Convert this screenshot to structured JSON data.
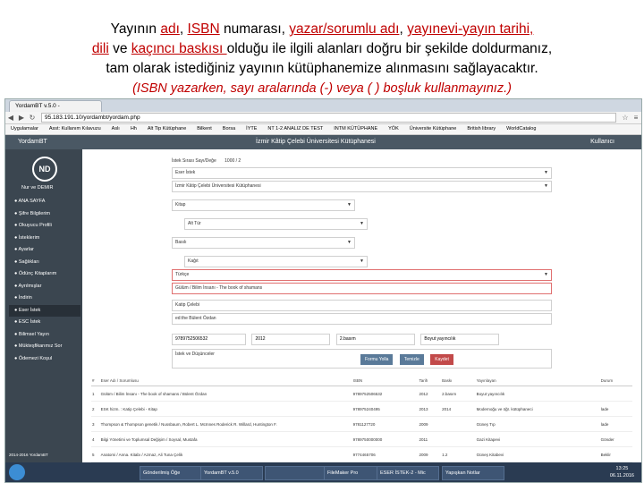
{
  "instructions": {
    "line1": [
      {
        "t": "Yayının ",
        "red": false
      },
      {
        "t": "adı",
        "red": true
      },
      {
        "t": ", ",
        "red": false
      },
      {
        "t": "ISBN",
        "red": true
      },
      {
        "t": " numarası, ",
        "red": false
      },
      {
        "t": "yazar/sorumlu adı",
        "red": true
      },
      {
        "t": ", ",
        "red": false
      },
      {
        "t": "yayınevi-yayın tarihi,",
        "red": true
      }
    ],
    "line2": [
      {
        "t": "dili",
        "red": true
      },
      {
        "t": " ve ",
        "red": false
      },
      {
        "t": "kaçıncı baskısı ",
        "red": true
      },
      {
        "t": "olduğu  ile ilgili alanları doğru bir şekilde doldurmanız,",
        "red": false
      }
    ],
    "line3": "tam olarak istediğiniz yayının kütüphanemize alınmasını sağlayacaktır.",
    "note": "(ISBN yazarken, sayı aralarında (-) veya (  ) boşluk kullanmayınız.)"
  },
  "browser": {
    "tab": "YordamBT v.5.0 -",
    "url": "95.183.191.10/yordambt/yordam.php",
    "bookmarks": [
      "Uygulamalar",
      "Asst: Kullanım Kılavuzu",
      "Aslı",
      "Hh",
      "Alt Tip Kütüphane",
      "Bilkent",
      "Borsa",
      "İYTE",
      "NT 1-2 ANALIZ DE TEST",
      "INTM KÜTÜPHANE",
      "YÖK",
      "Üniversite Kütüphane",
      "British library",
      "WorldCatalog"
    ]
  },
  "app": {
    "brand": "YordamBT",
    "title": "İzmir Kâtip Çelebi Üniversitesi Kütüphanesi",
    "user_button": "Kullanıcı",
    "avatar": "ND",
    "username": "Nur ve DEMIR",
    "menu": [
      "ANA SAYFA",
      "Şifre Bilgilerim",
      "Okuyucu Profili",
      "İsteklerim",
      "Ayarlar",
      "Sağlıkları",
      "Ödünç Kitaplarım",
      "Ayrılmışlar",
      "İndirin",
      "Eser İstek",
      "ESC İstek",
      "Bilimsel Yayın",
      "Mükteşfikarımız Sor",
      "Ödemezi Koşul"
    ],
    "active_menu": 9,
    "footer": "2014-2016 YordamBT"
  },
  "form": {
    "request_date_label": "İstek Sırası Sayı/Değe",
    "request_date": "1000 / 2",
    "request_type": "Eser İstek",
    "library": "İzmir Kâtip Çelebi Üniversitesi Kütüphanesi",
    "material_type": "Kitap",
    "item_type": "Alt Tür",
    "format": "Basılı",
    "format2": "Kağıt",
    "language": "Türkçe",
    "title_field": "Gülüm / Bilim İnsanı - The book of shamans",
    "author": "Katip Çelebi",
    "editor": "ed:the  Bülent Özdan",
    "isbn": "9789752506532",
    "year": "2012",
    "edition": "2.basım",
    "publisher": "Boyut yayıncılık",
    "notes_label": "İstek ve Düşünceler",
    "buttons": [
      "Formu Yolla",
      "Temizle",
      "Kaydet"
    ]
  },
  "table": {
    "headers": [
      "#",
      "Eser Adı / Sorumlusu",
      "ISBN",
      "Tarih",
      "Baskı",
      "Yayınlayan",
      "Durum"
    ],
    "rows": [
      [
        "1",
        "Gülüm / Bilim İnsanı - The book of shamans / Bülent Özdan",
        "9789752506532",
        "2012",
        "2.basım",
        "Boyut yayıncılık",
        ""
      ],
      [
        "2",
        "ESK hizm. : Katip Çelebi - Kitap",
        "978975240495",
        "2013",
        "2014",
        "Modernoğu ve öğr. kütüphaneci",
        "İade"
      ],
      [
        "3",
        "Thompson & Thompson genetik / Nussbaum, Robert L. McInnes Roderick R. Willard, Huntington F.",
        "9781127720",
        "2009",
        "",
        "Güneş Tıp",
        "İade"
      ],
      [
        "4",
        "Bilgi Yönetimi ve Toplumsal Değişim / Soysal, Mustafa",
        "9789750000000",
        "2011",
        "",
        "Gazi Kitapevi",
        "Gönder"
      ],
      [
        "5",
        "Anatomi / Anna. Kitabı / Azmaz, Ali Tuna Çelik",
        "9774465706",
        "2009",
        "1.2",
        "Güneş Kitabevi",
        "Beklir"
      ],
      [
        "6",
        "Anatomi I-III: Kemikler, Eklemler, Kaslar / Aydın, Hümi Kaplan",
        "978975211221",
        "2014",
        "5. Ba.",
        "Güneş Tıp",
        "Beklir"
      ]
    ]
  },
  "taskbar": {
    "items": [
      "Gönderilmiş Öğe",
      "YordamBT v.5.0",
      "",
      "FileMaker Pro",
      "ESER İSTEK-2 - Mic",
      "Yapışkan Notlar"
    ],
    "time": "13:25",
    "date": "06.11.2016"
  }
}
